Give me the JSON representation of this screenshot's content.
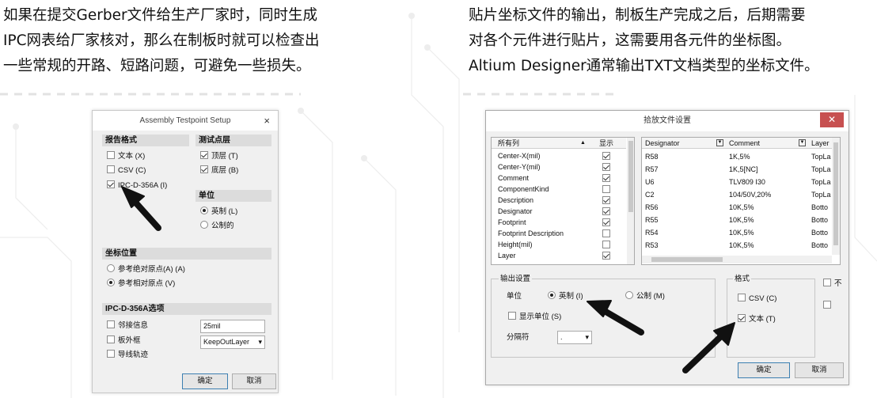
{
  "left_text": [
    "如果在提交Gerber文件给生产厂家时，同时生成",
    "IPC网表给厂家核对，那么在制板时就可以检查出",
    "一些常规的开路、短路问题，可避免一些损失。"
  ],
  "right_text": [
    "贴片坐标文件的输出，制板生产完成之后，后期需要",
    "对各个元件进行贴片，这需要用各元件的坐标图。",
    "Altium Designer通常输出TXT文档类型的坐标文件。"
  ],
  "dialog1": {
    "title": "Assembly Testpoint Setup",
    "close": "×",
    "report_format": {
      "heading": "报告格式",
      "items": [
        {
          "label": "文本 (X)",
          "checked": false
        },
        {
          "label": "CSV (C)",
          "checked": false
        },
        {
          "label": "IPC-D-356A (I)",
          "checked": true
        }
      ]
    },
    "test_layer": {
      "heading": "测试点层",
      "items": [
        {
          "label": "顶层 (T)",
          "checked": true
        },
        {
          "label": "底层 (B)",
          "checked": true
        }
      ]
    },
    "units": {
      "heading": "单位",
      "items": [
        {
          "label": "英制 (L)",
          "checked": true
        },
        {
          "label": "公制的",
          "checked": false
        }
      ]
    },
    "coord": {
      "heading": "坐标位置",
      "items": [
        {
          "label": "参考绝对原点(A) (A)",
          "checked": false
        },
        {
          "label": "参考相对原点 (V)",
          "checked": true
        }
      ]
    },
    "ipc_options": {
      "heading": "IPC-D-356A选项",
      "items": [
        {
          "label": "邻接信息",
          "checked": false
        },
        {
          "label": "板外框",
          "checked": false
        },
        {
          "label": "导线轨迹",
          "checked": false
        }
      ],
      "adjacency_value": "25mil",
      "outline_layer": "KeepOutLayer"
    },
    "ok": "确定",
    "cancel": "取消"
  },
  "dialog2": {
    "title": "拾放文件设置",
    "close": "✕",
    "columns_header": {
      "col1": "所有列",
      "col2": "显示"
    },
    "columns": [
      {
        "name": "Center-X(mil)",
        "shown": true
      },
      {
        "name": "Center-Y(mil)",
        "shown": true
      },
      {
        "name": "Comment",
        "shown": true
      },
      {
        "name": "ComponentKind",
        "shown": false
      },
      {
        "name": "Description",
        "shown": true
      },
      {
        "name": "Designator",
        "shown": true
      },
      {
        "name": "Footprint",
        "shown": true
      },
      {
        "name": "Footprint Description",
        "shown": false
      },
      {
        "name": "Height(mil)",
        "shown": false
      },
      {
        "name": "Layer",
        "shown": true
      }
    ],
    "preview_header": [
      "Designator",
      "Comment",
      "Layer"
    ],
    "preview_rows": [
      [
        "R58",
        "1K,5%",
        "TopLa"
      ],
      [
        "R57",
        "1K,5[NC]",
        "TopLa"
      ],
      [
        "U6",
        "TLV809 I30",
        "TopLa"
      ],
      [
        "C2",
        "104/50V,20%",
        "TopLa"
      ],
      [
        "R56",
        "10K,5%",
        "Botto"
      ],
      [
        "R55",
        "10K,5%",
        "Botto"
      ],
      [
        "R54",
        "10K,5%",
        "Botto"
      ],
      [
        "R53",
        "10K,5%",
        "Botto"
      ]
    ],
    "output": {
      "heading": "输出设置",
      "unit_label": "单位",
      "imperial": "英制 (I)",
      "metric": "公制 (M)",
      "show_units": "显示单位 (S)",
      "separator_label": "分隔符",
      "separator_value": "."
    },
    "format": {
      "heading": "格式",
      "csv": "CSV (C)",
      "text": "文本 (T)"
    },
    "side_glyph": "不",
    "ok": "确定",
    "cancel": "取消"
  }
}
